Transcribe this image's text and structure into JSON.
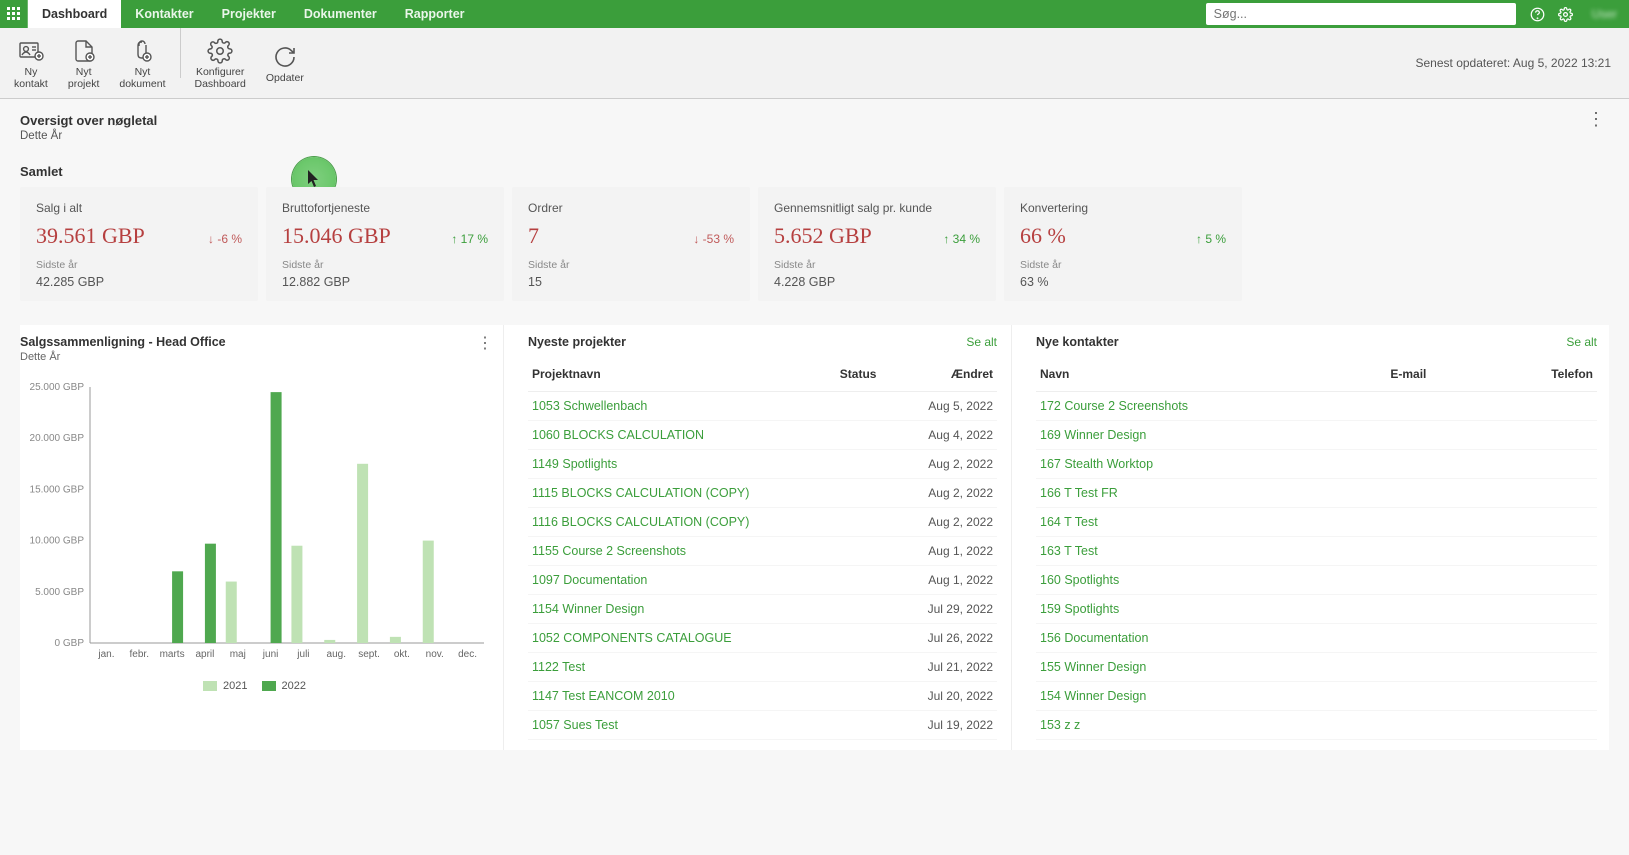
{
  "topbar": {
    "tabs": [
      "Dashboard",
      "Kontakter",
      "Projekter",
      "Dokumenter",
      "Rapporter"
    ],
    "active_tab": "Dashboard",
    "search_placeholder": "Søg...",
    "user_label": "User"
  },
  "toolbar": {
    "items": [
      {
        "label": "Ny\nkontakt",
        "icon_name": "new-contact-icon"
      },
      {
        "label": "Nyt\nprojekt",
        "icon_name": "new-project-icon"
      },
      {
        "label": "Nyt\ndokument",
        "icon_name": "new-document-icon"
      },
      {
        "label": "Konfigurer\nDashboard",
        "icon_name": "configure-icon"
      },
      {
        "label": "Opdater",
        "icon_name": "refresh-icon"
      }
    ],
    "last_updated": "Senest opdateret: Aug 5, 2022 13:21"
  },
  "overview": {
    "title": "Oversigt over nøgletal",
    "subtitle": "Dette År",
    "samlet_label": "Samlet",
    "kpis": [
      {
        "label": "Salg i alt",
        "value": "39.561 GBP",
        "change": "-6 %",
        "dir": "down",
        "prev_label": "Sidste år",
        "prev": "42.285 GBP"
      },
      {
        "label": "Bruttofortjeneste",
        "value": "15.046 GBP",
        "change": "17 %",
        "dir": "up",
        "prev_label": "Sidste år",
        "prev": "12.882 GBP"
      },
      {
        "label": "Ordrer",
        "value": "7",
        "change": "-53 %",
        "dir": "down",
        "prev_label": "Sidste år",
        "prev": "15"
      },
      {
        "label": "Gennemsnitligt salg pr. kunde",
        "value": "5.652 GBP",
        "change": "34 %",
        "dir": "up",
        "prev_label": "Sidste år",
        "prev": "4.228 GBP"
      },
      {
        "label": "Konvertering",
        "value": "66 %",
        "change": "5 %",
        "dir": "up",
        "prev_label": "Sidste år",
        "prev": "63 %"
      }
    ]
  },
  "chart_panel": {
    "title": "Salgssammenligning   -   Head Office",
    "subtitle": "Dette År",
    "legend": [
      "2021",
      "2022"
    ]
  },
  "chart_data": {
    "type": "bar",
    "categories": [
      "jan.",
      "febr.",
      "marts",
      "april",
      "maj",
      "juni",
      "juli",
      "aug.",
      "sept.",
      "okt.",
      "nov.",
      "dec."
    ],
    "series": [
      {
        "name": "2021",
        "color": "#bfe2b4",
        "values": [
          0,
          0,
          0,
          0,
          6000,
          0,
          9500,
          300,
          17500,
          600,
          10000,
          0
        ]
      },
      {
        "name": "2022",
        "color": "#4fa84f",
        "values": [
          0,
          0,
          7000,
          9700,
          0,
          24500,
          0,
          0,
          0,
          0,
          0,
          0
        ]
      }
    ],
    "ylim": [
      0,
      25000
    ],
    "yticks": [
      "0 GBP",
      "5.000 GBP",
      "10.000 GBP",
      "15.000 GBP",
      "20.000 GBP",
      "25.000 GBP"
    ],
    "xlabel": "",
    "ylabel": ""
  },
  "projects": {
    "title": "Nyeste projekter",
    "see_all": "Se alt",
    "columns": [
      "Projektnavn",
      "Status",
      "Ændret"
    ],
    "rows": [
      {
        "name": "1053 Schwellenbach",
        "status": "",
        "date": "Aug 5, 2022"
      },
      {
        "name": "1060 BLOCKS CALCULATION",
        "status": "",
        "date": "Aug 4, 2022"
      },
      {
        "name": "1149 Spotlights",
        "status": "",
        "date": "Aug 2, 2022"
      },
      {
        "name": "1115 BLOCKS CALCULATION (COPY)",
        "status": "",
        "date": "Aug 2, 2022"
      },
      {
        "name": "1116 BLOCKS CALCULATION (COPY)",
        "status": "",
        "date": "Aug 2, 2022"
      },
      {
        "name": "1155 Course 2 Screenshots",
        "status": "",
        "date": "Aug 1, 2022"
      },
      {
        "name": "1097 Documentation",
        "status": "",
        "date": "Aug 1, 2022"
      },
      {
        "name": "1154 Winner Design",
        "status": "",
        "date": "Jul 29, 2022"
      },
      {
        "name": "1052 COMPONENTS CATALOGUE",
        "status": "",
        "date": "Jul 26, 2022"
      },
      {
        "name": "1122 Test",
        "status": "",
        "date": "Jul 21, 2022"
      },
      {
        "name": "1147 Test EANCOM 2010",
        "status": "",
        "date": "Jul 20, 2022"
      },
      {
        "name": "1057 Sues Test",
        "status": "",
        "date": "Jul 19, 2022"
      }
    ]
  },
  "contacts": {
    "title": "Nye kontakter",
    "see_all": "Se alt",
    "columns": [
      "Navn",
      "E-mail",
      "Telefon"
    ],
    "rows": [
      {
        "name": "172 Course 2 Screenshots",
        "email": "",
        "phone": ""
      },
      {
        "name": "169 Winner Design",
        "email": "",
        "phone": ""
      },
      {
        "name": "167 Stealth Worktop",
        "email": "",
        "phone": ""
      },
      {
        "name": "166 T Test FR",
        "email": "",
        "phone": ""
      },
      {
        "name": "164 T Test",
        "email": "",
        "phone": ""
      },
      {
        "name": "163 T Test",
        "email": "",
        "phone": ""
      },
      {
        "name": "160 Spotlights",
        "email": "",
        "phone": ""
      },
      {
        "name": "159 Spotlights",
        "email": "",
        "phone": ""
      },
      {
        "name": "156 Documentation",
        "email": "",
        "phone": ""
      },
      {
        "name": "155 Winner Design",
        "email": "",
        "phone": ""
      },
      {
        "name": "154 Winner Design",
        "email": "",
        "phone": ""
      },
      {
        "name": "153 z z",
        "email": "",
        "phone": ""
      }
    ]
  }
}
